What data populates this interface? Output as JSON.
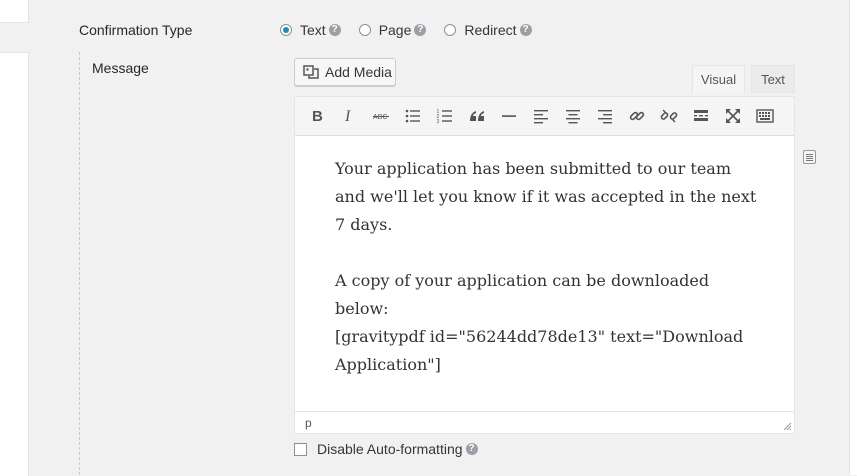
{
  "confirmation": {
    "label": "Confirmation Type",
    "options": [
      {
        "label": "Text",
        "checked": true
      },
      {
        "label": "Page",
        "checked": false
      },
      {
        "label": "Redirect",
        "checked": false
      }
    ]
  },
  "message": {
    "label": "Message",
    "add_media_label": "Add Media",
    "tabs": {
      "visual": "Visual",
      "text": "Text"
    },
    "content": {
      "p1_lines": [
        "Your application has been submitted to our team",
        "and we'll let you know if it was accepted in the next",
        "7 days."
      ],
      "p2_lines": [
        "A copy of your application can be downloaded",
        "below:",
        "[gravitypdf id=\"56244dd78de13\" text=\"Download",
        "Application\"]"
      ]
    },
    "status_path": "p"
  },
  "auto_format": {
    "label": "Disable Auto-formatting",
    "checked": false
  },
  "toolbar": {
    "buttons": [
      "bold-icon",
      "italic-icon",
      "strikethrough-icon",
      "bullet-list-icon",
      "numbered-list-icon",
      "blockquote-icon",
      "horizontal-rule-icon",
      "align-left-icon",
      "align-center-icon",
      "align-right-icon",
      "link-icon",
      "unlink-icon",
      "read-more-icon",
      "fullscreen-icon",
      "toolbar-toggle-icon"
    ]
  }
}
